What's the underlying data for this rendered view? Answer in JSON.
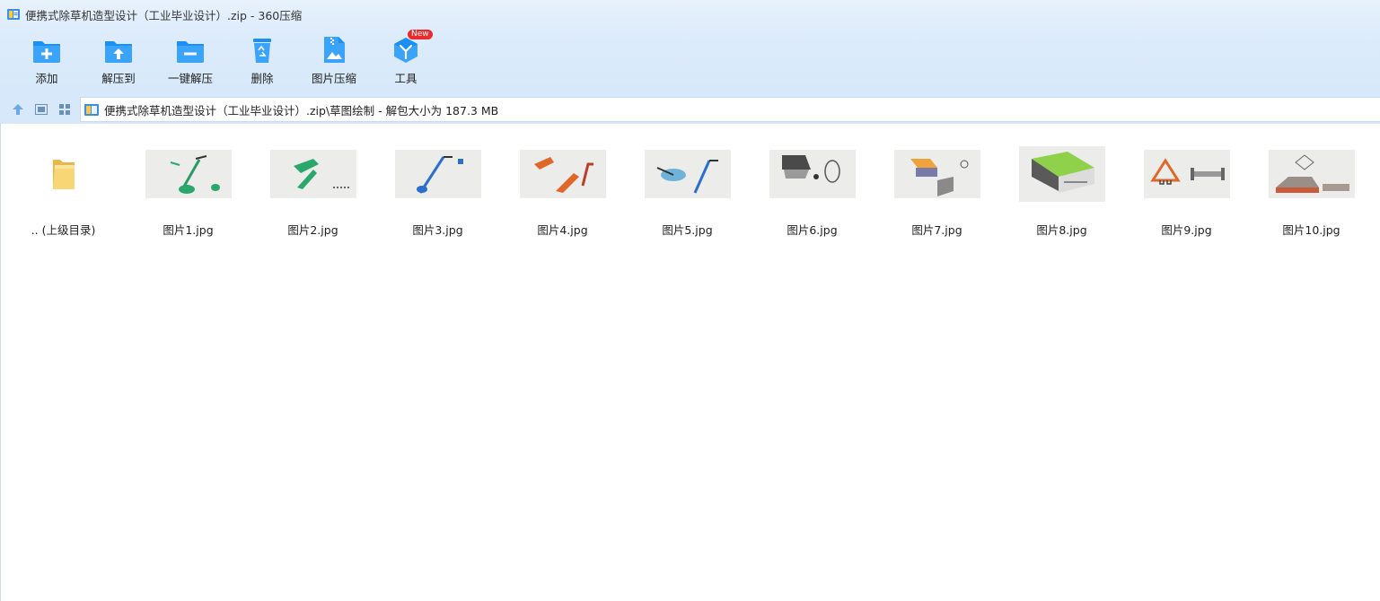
{
  "window": {
    "title": "便携式除草机造型设计（工业毕业设计）.zip - 360压缩",
    "app_icon": "archive-icon"
  },
  "toolbar": {
    "buttons": [
      {
        "label": "添加",
        "icon": "add-folder-icon"
      },
      {
        "label": "解压到",
        "icon": "extract-to-icon"
      },
      {
        "label": "一键解压",
        "icon": "one-click-extract-icon"
      },
      {
        "label": "删除",
        "icon": "recycle-bin-icon"
      },
      {
        "label": "图片压缩",
        "icon": "image-compress-icon"
      },
      {
        "label": "工具",
        "icon": "tools-cube-icon",
        "badge": "New"
      }
    ]
  },
  "navbar": {
    "up_icon": "arrow-up-icon",
    "view_detail_icon": "detail-view-icon",
    "view_grid_icon": "grid-view-icon"
  },
  "address": {
    "path": "便携式除草机造型设计（工业毕业设计）.zip\\草图绘制 - 解包大小为 187.3 MB"
  },
  "files": [
    {
      "name": ".. (上级目录)",
      "type": "parent-folder"
    },
    {
      "name": "图片1.jpg",
      "type": "image"
    },
    {
      "name": "图片2.jpg",
      "type": "image"
    },
    {
      "name": "图片3.jpg",
      "type": "image"
    },
    {
      "name": "图片4.jpg",
      "type": "image"
    },
    {
      "name": "图片5.jpg",
      "type": "image"
    },
    {
      "name": "图片6.jpg",
      "type": "image"
    },
    {
      "name": "图片7.jpg",
      "type": "image"
    },
    {
      "name": "图片8.jpg",
      "type": "image"
    },
    {
      "name": "图片9.jpg",
      "type": "image"
    },
    {
      "name": "图片10.jpg",
      "type": "image"
    }
  ],
  "colors": {
    "accent": "#1a8ff5",
    "toolbar_bg": "#d6e8fa",
    "badge": "#ea2b2b"
  }
}
